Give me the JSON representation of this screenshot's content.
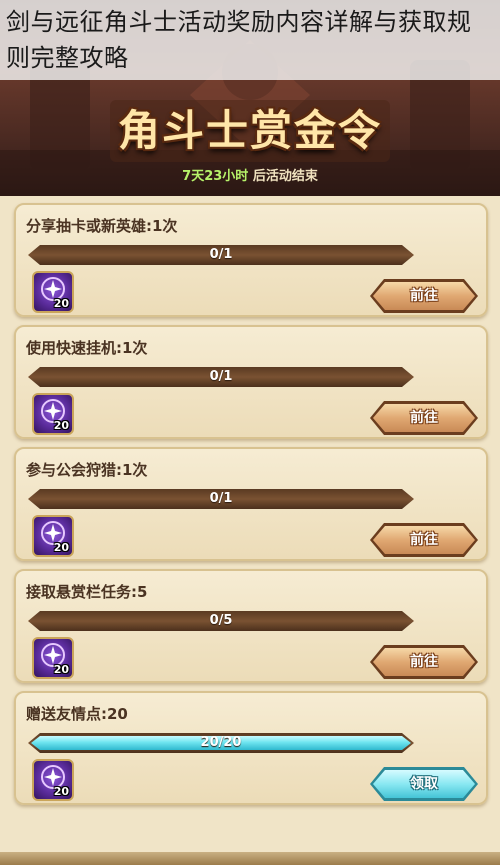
{
  "page_title": "剑与远征角斗士活动奖励内容详解与获取规则完整攻略",
  "banner": {
    "title": "角斗士赏金令",
    "countdown_time": "7天23小时",
    "countdown_suffix": " 后活动结束"
  },
  "tasks": [
    {
      "title": "分享抽卡或新英雄:1次",
      "progress_text": "0/1",
      "progress": 0,
      "reward_count": "20",
      "button_label": "前往",
      "button_type": "go"
    },
    {
      "title": "使用快速挂机:1次",
      "progress_text": "0/1",
      "progress": 0,
      "reward_count": "20",
      "button_label": "前往",
      "button_type": "go"
    },
    {
      "title": "参与公会狩猎:1次",
      "progress_text": "0/1",
      "progress": 0,
      "reward_count": "20",
      "button_label": "前往",
      "button_type": "go"
    },
    {
      "title": "接取悬赏栏任务:5",
      "progress_text": "0/5",
      "progress": 0,
      "reward_count": "20",
      "button_label": "前往",
      "button_type": "go"
    },
    {
      "title": "赠送友情点:20",
      "progress_text": "20/20",
      "progress": 1,
      "reward_count": "20",
      "button_label": "领取",
      "button_type": "claim"
    }
  ],
  "colors": {
    "go_button": "#e0a872",
    "claim_button": "#8ae8f2",
    "progress_fill": "#6fe5f0",
    "countdown_time": "#b6f26a"
  },
  "icons": {
    "reward": "purple-star-token-icon"
  }
}
